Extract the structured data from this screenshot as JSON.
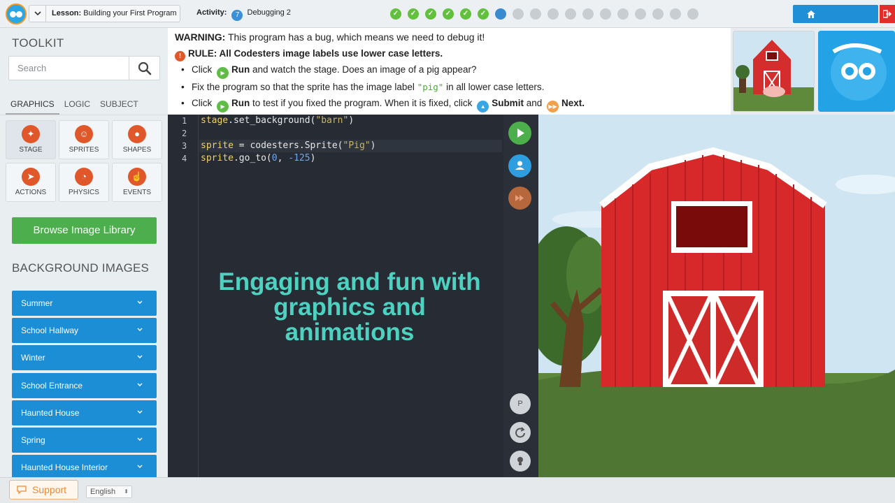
{
  "header": {
    "lesson_prefix": "Lesson:",
    "lesson_name": "Building your First Program",
    "activity_prefix": "Activity:",
    "activity_number": "7",
    "activity_name": "Debugging 2",
    "progress": {
      "completed": 6,
      "current": 7,
      "total": 18
    },
    "accent_blue": "#1f8fd8",
    "exit_red": "#e22d2d"
  },
  "toolkit": {
    "title": "TOOLKIT",
    "search_placeholder": "Search",
    "tabs": [
      {
        "label": "GRAPHICS",
        "active": true
      },
      {
        "label": "LOGIC",
        "active": false
      },
      {
        "label": "SUBJECT",
        "active": false
      }
    ],
    "categories": [
      {
        "label": "STAGE",
        "icon": "stage-icon",
        "selected": true
      },
      {
        "label": "SPRITES",
        "icon": "sprites-icon",
        "selected": false
      },
      {
        "label": "SHAPES",
        "icon": "shapes-icon",
        "selected": false
      },
      {
        "label": "ACTIONS",
        "icon": "actions-icon",
        "selected": false
      },
      {
        "label": "PHYSICS",
        "icon": "physics-icon",
        "selected": false
      },
      {
        "label": "EVENTS",
        "icon": "events-icon",
        "selected": false
      }
    ],
    "browse_button": "Browse Image Library",
    "background_title": "BACKGROUND IMAGES",
    "backgrounds": [
      "Summer",
      "School Hallway",
      "Winter",
      "School Entrance",
      "Haunted House",
      "Spring",
      "Haunted House Interior"
    ]
  },
  "instructions": {
    "warning_label": "WARNING:",
    "warning_text": "This program has a bug, which means we need to debug it!",
    "rule_text": "RULE: All Codesters image labels use lower case letters.",
    "step1_pre": "Click",
    "step1_bold": "Run",
    "step1_post": "and watch the stage. Does an image of a pig appear?",
    "step2_pre": "Fix the program so that the sprite has the image label",
    "step2_code": "\"pig\"",
    "step2_post": "in all lower case letters.",
    "step3_pre": "Click",
    "step3_bold": "Run",
    "step3_mid": "to test if you fixed the program. When it is fixed, click",
    "step3_submit": "Submit",
    "step3_and": "and",
    "step3_next": "Next."
  },
  "editor": {
    "line_numbers": [
      "1",
      "2",
      "3",
      "4"
    ],
    "line1": {
      "obj": "stage",
      "rest": ".set_background(",
      "str": "\"barn\"",
      "close": ")"
    },
    "line3": {
      "var": "sprite",
      "mid": " = codesters.Sprite(",
      "str": "\"Pig\"",
      "close": ")"
    },
    "line4": {
      "obj": "sprite",
      "mid": ".go_to(",
      "num1": "0",
      "comma": ", ",
      "num2": "-125",
      "close": ")"
    },
    "overlay_text": "Engaging and fun with graphics and animations"
  },
  "footer": {
    "support_label": "Support",
    "language": "English"
  }
}
